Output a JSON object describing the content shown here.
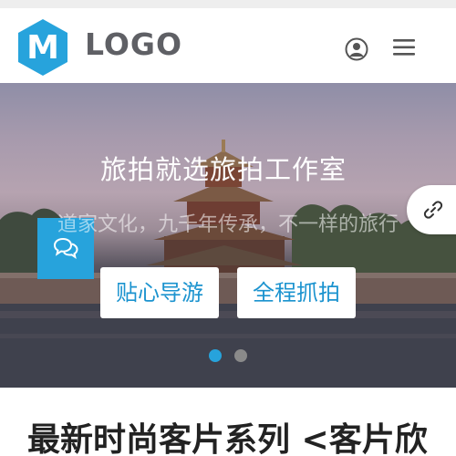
{
  "header": {
    "logo_letter": "M",
    "logo_text": "LOGO",
    "icons": {
      "user": "user-circle-icon",
      "menu": "hamburger-menu-icon"
    }
  },
  "hero": {
    "title": "旅拍就选旅拍工作室",
    "subtitle": "道家文化，九千年传承，不一样的旅行",
    "buttons": [
      "贴心导游",
      "全程抓拍"
    ],
    "slides": {
      "count": 2,
      "active": 1
    },
    "float_icon": "link-icon",
    "title_icon": "chat-bubbles-icon"
  },
  "section": {
    "title": "最新时尚客片系列 <客片欣"
  },
  "colors": {
    "accent": "#27a3dc",
    "logo_text": "#5f6065",
    "icon_gray": "#555555"
  }
}
